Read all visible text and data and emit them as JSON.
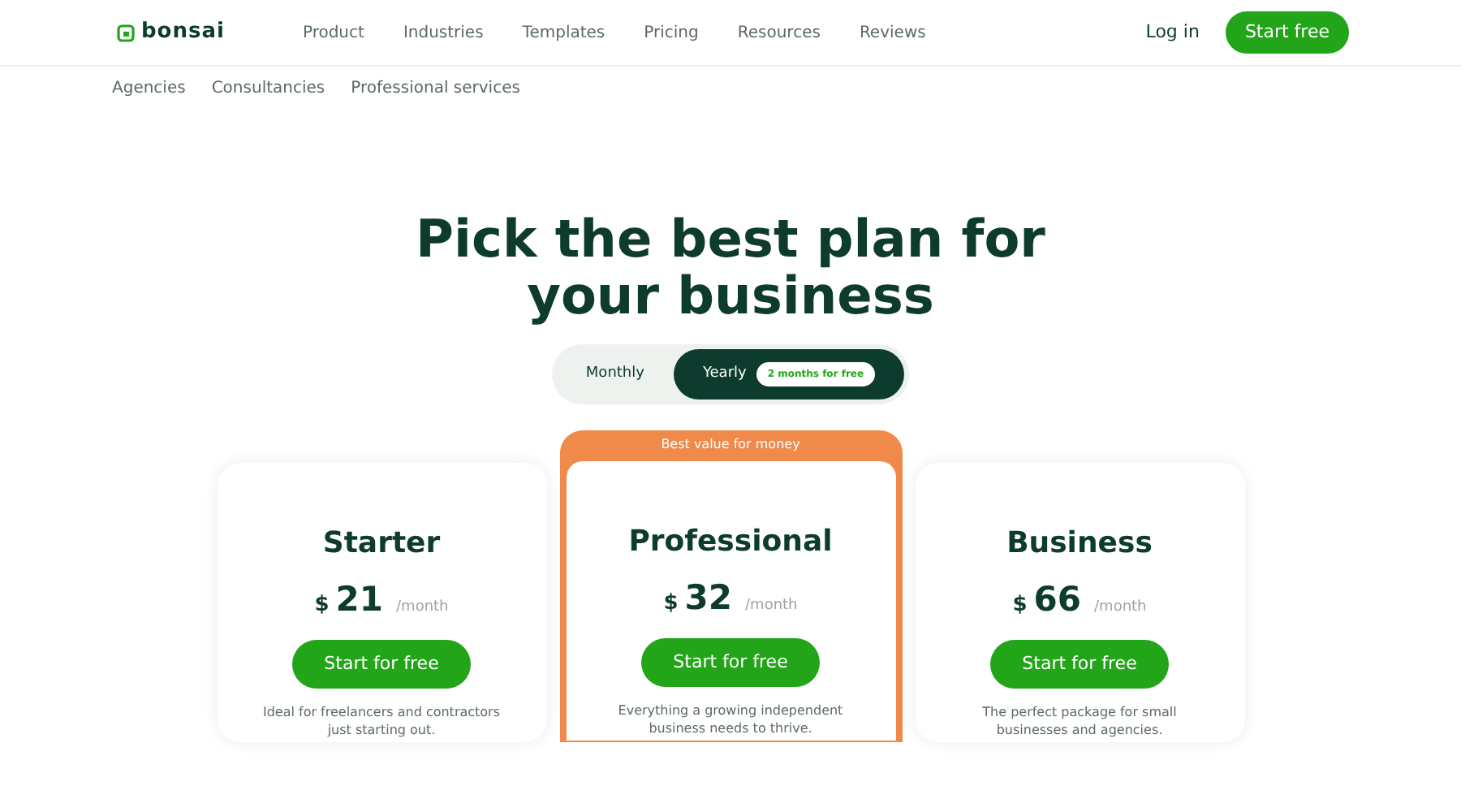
{
  "brand": {
    "name": "bonsai"
  },
  "nav": [
    {
      "label": "Product"
    },
    {
      "label": "Industries"
    },
    {
      "label": "Templates"
    },
    {
      "label": "Pricing"
    },
    {
      "label": "Resources"
    },
    {
      "label": "Reviews"
    }
  ],
  "login": "Log in",
  "cta": "Start free",
  "subnav": [
    {
      "label": "Agencies"
    },
    {
      "label": "Consultancies"
    },
    {
      "label": "Professional services"
    }
  ],
  "heading": "Pick the best plan for your business",
  "billing": [
    {
      "label": "Monthly",
      "selected": false
    },
    {
      "label": "Yearly",
      "selected": true,
      "badge": "2 months for free"
    }
  ],
  "plans": [
    {
      "name": "Starter",
      "currency": "$",
      "price": "21",
      "period": "/month",
      "button": "Start for free",
      "description": "Ideal for freelancers and contractors just starting out.",
      "featured": false
    },
    {
      "name": "Professional",
      "currency": "$",
      "price": "32",
      "period": "/month",
      "button": "Start for free",
      "description": "Everything a growing independent business needs to thrive.",
      "featured": true,
      "ribbon": "Best value for money"
    },
    {
      "name": "Business",
      "currency": "$",
      "price": "66",
      "period": "/month",
      "button": "Start for free",
      "description": "The perfect package for small businesses and agencies.",
      "featured": false
    }
  ]
}
